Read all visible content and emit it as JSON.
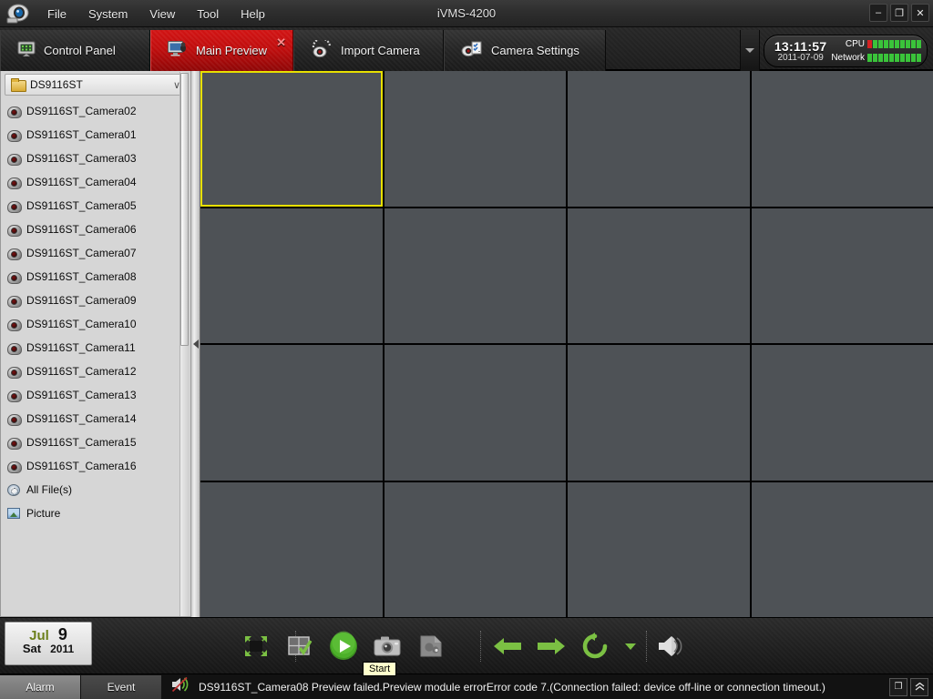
{
  "window": {
    "title": "iVMS-4200",
    "minimize_label": "–",
    "maximize_label": "❐",
    "close_label": "✕"
  },
  "menubar": {
    "items": [
      {
        "label": "File"
      },
      {
        "label": "System"
      },
      {
        "label": "View"
      },
      {
        "label": "Tool"
      },
      {
        "label": "Help"
      }
    ]
  },
  "tabs": [
    {
      "label": "Control Panel",
      "icon": "control-panel-icon",
      "active": false
    },
    {
      "label": "Main Preview",
      "icon": "monitor-icon",
      "active": true,
      "close_label": "✕"
    },
    {
      "label": "Import Camera",
      "icon": "camera-icon",
      "active": false
    },
    {
      "label": "Camera Settings",
      "icon": "camera-settings-icon",
      "active": false
    }
  ],
  "status_panel": {
    "time": "13:11:57",
    "date": "2011-07-09",
    "cpu_label": "CPU",
    "network_label": "Network",
    "cpu_segments": 10,
    "cpu_red_segments": 1,
    "network_segments": 10,
    "network_red_segments": 0,
    "green": "#3ac43a",
    "red": "#d42222"
  },
  "sidebar": {
    "group": {
      "label": "DS9116ST",
      "chevron": "∨"
    },
    "cameras": [
      {
        "label": "DS9116ST_Camera02"
      },
      {
        "label": "DS9116ST_Camera01"
      },
      {
        "label": "DS9116ST_Camera03"
      },
      {
        "label": "DS9116ST_Camera04"
      },
      {
        "label": "DS9116ST_Camera05"
      },
      {
        "label": "DS9116ST_Camera06"
      },
      {
        "label": "DS9116ST_Camera07"
      },
      {
        "label": "DS9116ST_Camera08"
      },
      {
        "label": "DS9116ST_Camera09"
      },
      {
        "label": "DS9116ST_Camera10"
      },
      {
        "label": "DS9116ST_Camera11"
      },
      {
        "label": "DS9116ST_Camera12"
      },
      {
        "label": "DS9116ST_Camera13"
      },
      {
        "label": "DS9116ST_Camera14"
      },
      {
        "label": "DS9116ST_Camera15"
      },
      {
        "label": "DS9116ST_Camera16"
      }
    ],
    "misc": [
      {
        "label": "All File(s)",
        "icon": "all-files-icon"
      },
      {
        "label": "Picture",
        "icon": "picture-icon"
      }
    ]
  },
  "grid": {
    "rows": 4,
    "columns": 4,
    "selected_cell": 0,
    "cell_color": "#4e5256",
    "selection_color": "#e8e000"
  },
  "calendar": {
    "month": "Jul",
    "day": "9",
    "weekday": "Sat",
    "year": "2011"
  },
  "toolbar": {
    "buttons": [
      {
        "name": "full-screen-button",
        "icon": "fullscreen-icon"
      },
      {
        "name": "layout-button",
        "icon": "layout-check-icon"
      },
      {
        "name": "start-button",
        "icon": "play-icon"
      },
      {
        "name": "capture-button",
        "icon": "camera-snapshot-icon"
      },
      {
        "name": "record-button",
        "icon": "record-icon"
      },
      {
        "name": "previous-button",
        "icon": "arrow-left-icon"
      },
      {
        "name": "next-button",
        "icon": "arrow-right-icon"
      },
      {
        "name": "loop-button",
        "icon": "refresh-icon"
      },
      {
        "name": "loop-dropdown",
        "icon": "chevron-down-icon"
      },
      {
        "name": "volume-button",
        "icon": "speaker-icon"
      }
    ],
    "tooltip": "Start"
  },
  "statusbar": {
    "tabs": [
      {
        "label": "Alarm",
        "selected": true
      },
      {
        "label": "Event",
        "selected": false
      }
    ],
    "speaker_icon": "speaker-muted-icon",
    "message": "DS9116ST_Camera08 Preview failed.Preview module errorError code 7.(Connection failed: device off-line or connection timeout.)",
    "buttons": [
      {
        "name": "restore-panel-button",
        "label": "❐"
      },
      {
        "name": "collapse-panel-button",
        "label": "«"
      }
    ]
  }
}
